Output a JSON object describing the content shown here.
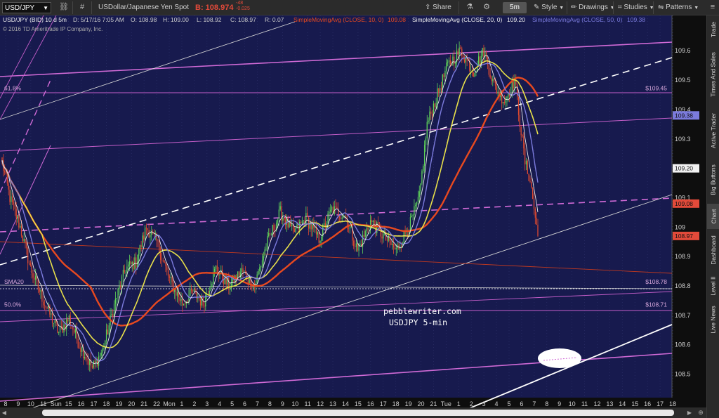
{
  "toolbar": {
    "symbol": "USD/JPY",
    "instrument": "USDollar/Japanese Yen Spot",
    "bid_label": "B:",
    "bid_value": "108.974",
    "change_top": "-48",
    "change_bottom": "-0.025",
    "share": "Share",
    "timeframe": "5m",
    "style": "Style",
    "drawings": "Drawings",
    "studies": "Studies",
    "patterns": "Patterns"
  },
  "header_line": {
    "symbol": "USD/JPY (BID) 10 d 5m",
    "date": "D: 5/17/16 7:05 AM",
    "open": "O: 108.98",
    "high": "H: 109.00",
    "low": "L: 108.92",
    "close": "C: 108.97",
    "range": "R: 0.07",
    "sma10": "SimpleMovingAvg (CLOSE, 10, 0)",
    "sma10_val": "109.08",
    "sma20": "SimpleMovingAvg (CLOSE, 20, 0)",
    "sma20_val": "109.20",
    "sma50": "SimpleMovingAvg (CLOSE, 50, 0)",
    "sma50_val": "109.38"
  },
  "copyright": "© 2016 TD Ameritrade IP Company, Inc.",
  "right_tabs": [
    "Trade",
    "Times And Sales",
    "Active Trader",
    "Big Buttons",
    "Chart",
    "Dashboard",
    "Level II",
    "Live News"
  ],
  "chart_data": {
    "type": "candlestick",
    "ylim": [
      108.42,
      109.72
    ],
    "y_ticks": [
      "109.6",
      "109.5",
      "109.4",
      "109.3",
      "109.2",
      "109.1",
      "109",
      "108.9",
      "108.8",
      "108.7",
      "108.6",
      "108.5"
    ],
    "x_ticks": [
      "8",
      "9",
      "10",
      "11",
      "Sun",
      "15",
      "16",
      "17",
      "18",
      "19",
      "20",
      "21",
      "22",
      "Mon",
      "1",
      "2",
      "3",
      "4",
      "5",
      "6",
      "7",
      "8",
      "9",
      "10",
      "11",
      "12",
      "13",
      "14",
      "15",
      "16",
      "17",
      "18",
      "19",
      "20",
      "21",
      "Tue",
      "1",
      "2",
      "3",
      "4",
      "5",
      "6",
      "7",
      "8",
      "9",
      "10",
      "11",
      "12",
      "13",
      "14",
      "15",
      "16",
      "17",
      "18"
    ],
    "price_boxes": [
      {
        "label": "109.38",
        "value": 109.38,
        "color": "#7b7bdc"
      },
      {
        "label": "109.20",
        "value": 109.2,
        "color": "#f2f2f2"
      },
      {
        "label": "109.08",
        "value": 109.08,
        "color": "#e24a3a"
      },
      {
        "label": "108.97",
        "value": 108.97,
        "color": "#e24a3a"
      }
    ],
    "level_labels": [
      {
        "text": "61.8%",
        "value": 109.458
      },
      {
        "text": "SMA20",
        "value": 108.8
      },
      {
        "text": "50.0%",
        "value": 108.722
      }
    ],
    "price_level_labels": [
      {
        "text": "$109.45",
        "value": 109.458
      },
      {
        "text": "$108.78",
        "value": 108.8
      },
      {
        "text": "$108.71",
        "value": 108.722
      }
    ],
    "annotation": [
      "pebblewriter.com",
      "USDJPY 5-min"
    ],
    "anchors": [
      {
        "i": 0,
        "v": 109.22
      },
      {
        "i": 6,
        "v": 109.1
      },
      {
        "i": 14,
        "v": 109.0
      },
      {
        "i": 22,
        "v": 108.86
      },
      {
        "i": 32,
        "v": 108.75
      },
      {
        "i": 44,
        "v": 108.64
      },
      {
        "i": 52,
        "v": 108.69
      },
      {
        "i": 60,
        "v": 108.6
      },
      {
        "i": 70,
        "v": 108.52
      },
      {
        "i": 78,
        "v": 108.58
      },
      {
        "i": 88,
        "v": 108.75
      },
      {
        "i": 96,
        "v": 108.86
      },
      {
        "i": 104,
        "v": 108.88
      },
      {
        "i": 112,
        "v": 109.0
      },
      {
        "i": 120,
        "v": 108.95
      },
      {
        "i": 130,
        "v": 108.82
      },
      {
        "i": 140,
        "v": 108.74
      },
      {
        "i": 148,
        "v": 108.78
      },
      {
        "i": 156,
        "v": 108.74
      },
      {
        "i": 166,
        "v": 108.86
      },
      {
        "i": 176,
        "v": 108.8
      },
      {
        "i": 186,
        "v": 108.85
      },
      {
        "i": 196,
        "v": 108.8
      },
      {
        "i": 206,
        "v": 108.95
      },
      {
        "i": 216,
        "v": 109.05
      },
      {
        "i": 226,
        "v": 108.98
      },
      {
        "i": 236,
        "v": 109.03
      },
      {
        "i": 246,
        "v": 108.96
      },
      {
        "i": 256,
        "v": 109.06
      },
      {
        "i": 266,
        "v": 109.04
      },
      {
        "i": 276,
        "v": 108.92
      },
      {
        "i": 286,
        "v": 109.02
      },
      {
        "i": 296,
        "v": 108.97
      },
      {
        "i": 306,
        "v": 108.92
      },
      {
        "i": 316,
        "v": 109.0
      },
      {
        "i": 324,
        "v": 109.1
      },
      {
        "i": 330,
        "v": 109.35
      },
      {
        "i": 338,
        "v": 109.45
      },
      {
        "i": 346,
        "v": 109.55
      },
      {
        "i": 356,
        "v": 109.6
      },
      {
        "i": 366,
        "v": 109.53
      },
      {
        "i": 374,
        "v": 109.6
      },
      {
        "i": 382,
        "v": 109.48
      },
      {
        "i": 390,
        "v": 109.43
      },
      {
        "i": 398,
        "v": 109.5
      },
      {
        "i": 406,
        "v": 109.22
      },
      {
        "i": 410,
        "v": 109.16
      },
      {
        "i": 416,
        "v": 108.97
      }
    ],
    "n_bars": 417
  },
  "colors": {
    "background": "#171a4e",
    "sma10": "#e9e9e9",
    "sma20": "#7b7bdc",
    "sma50": "#e8e04a",
    "sma200": "#e8491f",
    "trend_magenta": "#d06ad6",
    "trend_white": "#ffffff",
    "candle_up": "#5fd35a",
    "candle_down": "#e04a2f"
  }
}
